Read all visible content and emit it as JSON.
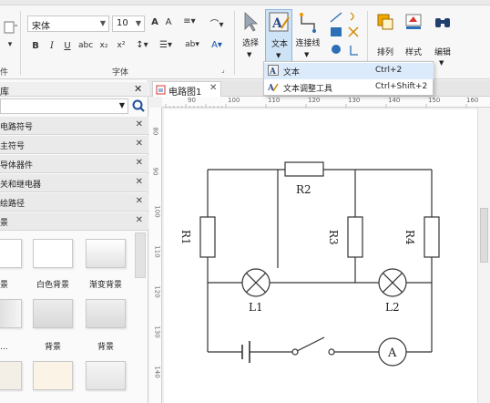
{
  "ribbon": {
    "font_name": "宋体",
    "font_size": "10",
    "font_group_label": "字体",
    "left_group_label": "件",
    "tools": {
      "select_label": "选择",
      "text_label": "文本",
      "connector_label": "连接线",
      "arrange_label": "排列",
      "style_label": "样式",
      "edit_label": "编辑"
    }
  },
  "text_menu": {
    "items": [
      {
        "label": "文本",
        "shortcut": "Ctrl+2"
      },
      {
        "label": "文本调整工具",
        "shortcut": "Ctrl+Shift+2"
      }
    ]
  },
  "library_panel": {
    "title": "库",
    "search_value": "",
    "sections": [
      "电路符号",
      "主符号",
      "导体器件",
      "关和继电器",
      "绘路径",
      "景"
    ],
    "thumbnails": [
      {
        "label": "背景"
      },
      {
        "label": "白色背景"
      },
      {
        "label": "渐变背景"
      },
      {
        "label": "变..."
      },
      {
        "label": "背景"
      },
      {
        "label": "背景"
      },
      {
        "label": ""
      },
      {
        "label": ""
      },
      {
        "label": ""
      }
    ]
  },
  "document_tab": {
    "label": "电路图1"
  },
  "ruler_h": [
    "90",
    "100",
    "110",
    "120",
    "130",
    "140",
    "150",
    "160"
  ],
  "ruler_v": [
    "80",
    "90",
    "100",
    "110",
    "120",
    "130",
    "140"
  ],
  "circuit": {
    "labels": {
      "r1": "R1",
      "r2": "R2",
      "r3": "R3",
      "r4": "R4",
      "l1": "L1",
      "l2": "L2",
      "ammeter": "A"
    }
  },
  "colors": {
    "accent": "#2b6fb6",
    "selected_tool_bg": "#cfe3f7"
  }
}
